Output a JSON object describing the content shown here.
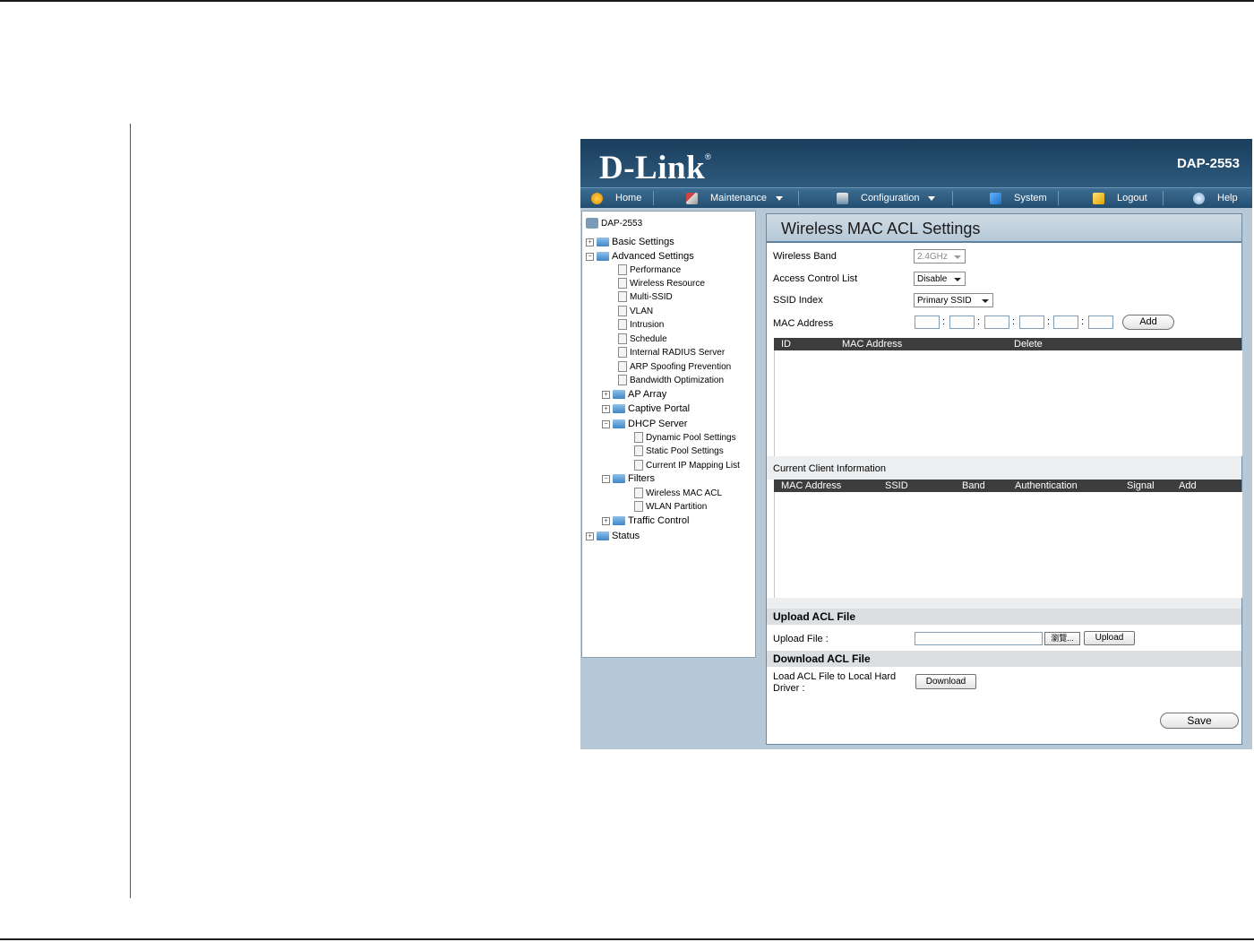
{
  "header": {
    "logo": "D-Link",
    "model": "DAP-2553"
  },
  "menu": [
    {
      "label": "Home"
    },
    {
      "label": "Maintenance"
    },
    {
      "label": "Configuration"
    },
    {
      "label": "System"
    },
    {
      "label": "Logout"
    },
    {
      "label": "Help"
    }
  ],
  "tree": {
    "root": "DAP-2553",
    "basic": "Basic Settings",
    "advanced": "Advanced Settings",
    "performance": "Performance",
    "wireless_resource": "Wireless Resource",
    "multi_ssid": "Multi-SSID",
    "vlan": "VLAN",
    "intrusion": "Intrusion",
    "schedule": "Schedule",
    "radius": "Internal RADIUS Server",
    "arp": "ARP Spoofing Prevention",
    "bandwidth": "Bandwidth Optimization",
    "ap_array": "AP Array",
    "captive": "Captive Portal",
    "dhcp": "DHCP Server",
    "dynamic_pool": "Dynamic Pool Settings",
    "static_pool": "Static Pool Settings",
    "ip_mapping": "Current IP Mapping List",
    "filters": "Filters",
    "mac_acl": "Wireless MAC ACL",
    "wlan_partition": "WLAN Partition",
    "traffic": "Traffic Control",
    "status": "Status"
  },
  "content": {
    "title": "Wireless MAC ACL Settings",
    "wireless_band_label": "Wireless Band",
    "wireless_band_value": "2.4GHz",
    "acl_label": "Access Control List",
    "acl_value": "Disable",
    "ssid_label": "SSID Index",
    "ssid_value": "Primary SSID",
    "mac_label": "MAC Address",
    "add_button": "Add",
    "acl_table": {
      "id": "ID",
      "mac": "MAC Address",
      "delete": "Delete"
    },
    "client_title": "Current Client Information",
    "client_table": {
      "mac": "MAC Address",
      "ssid": "SSID",
      "band": "Band",
      "auth": "Authentication",
      "signal": "Signal",
      "add": "Add"
    },
    "upload_section": "Upload ACL File",
    "upload_label": "Upload File :",
    "browse_button": "瀏覽...",
    "upload_button": "Upload",
    "download_section": "Download ACL File",
    "download_label_1": "Load ACL File to Local Hard",
    "download_label_2": "Driver :",
    "download_button": "Download",
    "save_button": "Save"
  }
}
